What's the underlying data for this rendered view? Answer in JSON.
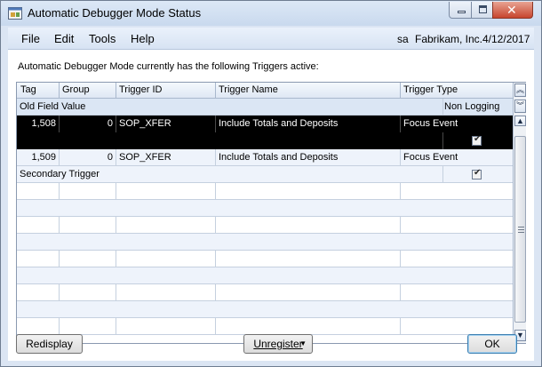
{
  "window": {
    "title": "Automatic Debugger Mode Status"
  },
  "menu": {
    "items": [
      "File",
      "Edit",
      "Tools",
      "Help"
    ],
    "user": "sa",
    "company": "Fabrikam, Inc.",
    "date": "4/12/2017"
  },
  "intro_text": "Automatic Debugger Mode currently has the following Triggers active:",
  "grid": {
    "headers": [
      "Tag",
      "Group",
      "Trigger ID",
      "Trigger Name",
      "Trigger Type"
    ],
    "subheader_left": "Old Field Value",
    "subheader_right": "Non Logging",
    "rows": [
      {
        "tag": "1,508",
        "group": "0",
        "trigger_id": "SOP_XFER",
        "trigger_name": "Include Totals and Deposits",
        "trigger_type": "Focus Event",
        "secondary_label": "",
        "checked": true
      },
      {
        "tag": "1,509",
        "group": "0",
        "trigger_id": "SOP_XFER",
        "trigger_name": "Include Totals and Deposits",
        "trigger_type": "Focus Event",
        "secondary_label": "Secondary Trigger",
        "checked": true
      }
    ]
  },
  "buttons": {
    "redisplay": "Redisplay",
    "unregister": "Unregister",
    "ok": "OK"
  },
  "icons": {
    "app": "debugger-window-icon",
    "collapse": "double-chevron-up-icon",
    "expand": "double-chevron-down-icon"
  }
}
